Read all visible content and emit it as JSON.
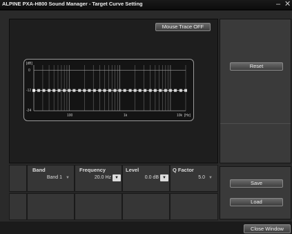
{
  "window": {
    "title": "ALPINE PXA-H800 Sound Manager  -  Target Curve Setting",
    "minimize": "–",
    "close": "✕"
  },
  "graph": {
    "mouse_trace_label": "Mouse Trace OFF",
    "y_unit": "[dB]",
    "y_ticks": [
      "0",
      "-12",
      "-24"
    ],
    "x_ticks": [
      "100",
      "1k",
      "10k"
    ],
    "x_unit": "[Hz]"
  },
  "buttons": {
    "reset": "Reset",
    "save": "Save",
    "load": "Load",
    "close_window": "Close Window"
  },
  "band_table": {
    "headers": {
      "band": "Band",
      "frequency": "Frequency",
      "level": "Level",
      "q_factor": "Q Factor"
    },
    "values": {
      "band": "Band 1",
      "frequency": "20.0 Hz",
      "level": "0.0 dB",
      "q_factor": "5.0"
    }
  },
  "chart_data": {
    "type": "line",
    "ylabel": "[dB]",
    "xlabel": "[Hz]",
    "x_scale": "log",
    "xlim": [
      20,
      20000
    ],
    "ylim": [
      -24,
      3
    ],
    "y_ticks": [
      0,
      -12,
      -24
    ],
    "x_ticks": [
      100,
      1000,
      10000
    ],
    "x": [
      20,
      25,
      31.5,
      40,
      50,
      63,
      80,
      100,
      125,
      160,
      200,
      250,
      315,
      400,
      500,
      630,
      800,
      1000,
      1250,
      1600,
      2000,
      2500,
      3150,
      4000,
      5000,
      6300,
      8000,
      10000,
      12500,
      16000,
      20000
    ],
    "y": [
      -12,
      -12,
      -12,
      -12,
      -12,
      -12,
      -12,
      -12,
      -12,
      -12,
      -12,
      -12,
      -12,
      -12,
      -12,
      -12,
      -12,
      -12,
      -12,
      -12,
      -12,
      -12,
      -12,
      -12,
      -12,
      -12,
      -12,
      -12,
      -12,
      -12,
      -12
    ]
  }
}
